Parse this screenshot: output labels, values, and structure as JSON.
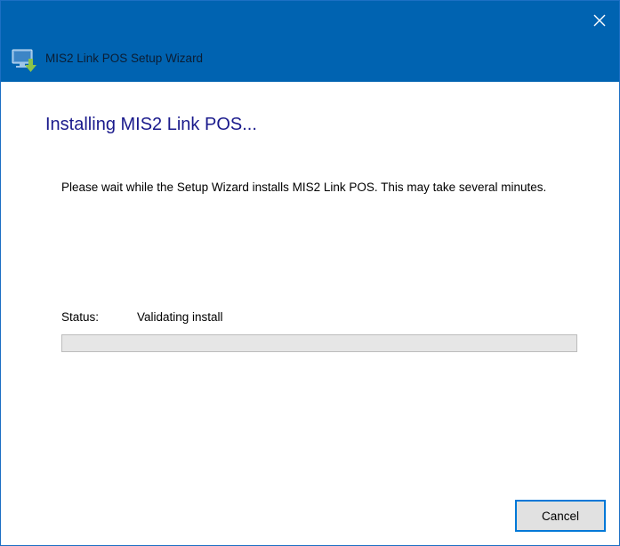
{
  "window": {
    "title": "MIS2 Link POS Setup Wizard",
    "title_bar_color": "#0063b1",
    "icons": {
      "app": "installer-icon",
      "close": "close-icon"
    }
  },
  "page": {
    "heading": "Installing MIS2 Link POS...",
    "description": "Please wait while the Setup Wizard installs MIS2 Link POS.  This may take several minutes.",
    "status_label": "Status:",
    "status_value": "Validating install",
    "progress": 0
  },
  "buttons": {
    "cancel": "Cancel"
  }
}
